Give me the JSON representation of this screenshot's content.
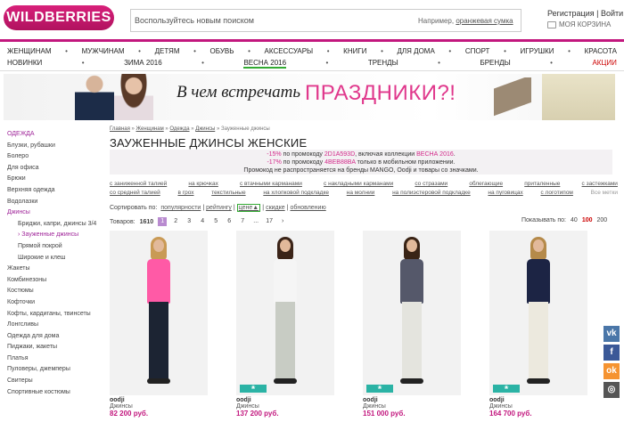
{
  "header": {
    "logo": "WILDBERRIES",
    "search_placeholder": "Воспользуйтесь новым поиском",
    "search_hint_prefix": "Например, ",
    "search_hint_link": "оранжевая сумка",
    "auth": "Регистрация | Войти",
    "cart_label": "МОЯ КОРЗИНА"
  },
  "nav": {
    "row1": [
      "ЖЕНЩИНАМ",
      "МУЖЧИНАМ",
      "ДЕТЯМ",
      "ОБУВЬ",
      "АКСЕССУАРЫ",
      "КНИГИ",
      "ДЛЯ ДОМА",
      "СПОРТ",
      "ИГРУШКИ",
      "КРАСОТА"
    ],
    "row2": [
      "НОВИНКИ",
      "ЗИМА 2016",
      "ВЕСНА 2016",
      "ТРЕНДЫ",
      "БРЕНДЫ",
      "АКЦИИ"
    ]
  },
  "banner": {
    "text": "В чем встречать",
    "highlight": "ПРАЗДНИКИ?!"
  },
  "sidebar": {
    "category": "ОДЕЖДА",
    "items": [
      {
        "label": "Блузки, рубашки",
        "type": "item"
      },
      {
        "label": "Болеро",
        "type": "item"
      },
      {
        "label": "Для офиса",
        "type": "item"
      },
      {
        "label": "Брюки",
        "type": "item"
      },
      {
        "label": "Верхняя одежда",
        "type": "item"
      },
      {
        "label": "Водолазки",
        "type": "item"
      },
      {
        "label": "Джинсы",
        "type": "active"
      },
      {
        "label": "Бриджи, капри, джинсы 3/4",
        "type": "sub"
      },
      {
        "label": "› Зауженные джинсы",
        "type": "sub-active"
      },
      {
        "label": "Прямой покрой",
        "type": "sub"
      },
      {
        "label": "Широкие и клеш",
        "type": "sub"
      },
      {
        "label": "Жакеты",
        "type": "item"
      },
      {
        "label": "Комбинезоны",
        "type": "item"
      },
      {
        "label": "Костюмы",
        "type": "item"
      },
      {
        "label": "Кофточки",
        "type": "item"
      },
      {
        "label": "Кофты, кардиганы, твинсеты",
        "type": "item"
      },
      {
        "label": "Лонгсливы",
        "type": "item"
      },
      {
        "label": "Одежда для дома",
        "type": "item"
      },
      {
        "label": "Пиджаки, жакеты",
        "type": "item"
      },
      {
        "label": "Платья",
        "type": "item"
      },
      {
        "label": "Пуловеры, джемперы",
        "type": "item"
      },
      {
        "label": "Свитеры",
        "type": "item"
      },
      {
        "label": "Спортивные костюмы",
        "type": "item"
      }
    ]
  },
  "breadcrumb": [
    "Главная",
    "Женщинам",
    "Одежда",
    "Джинсы",
    "Зауженные джинсы"
  ],
  "page_title": "ЗАУЖЕННЫЕ ДЖИНСЫ ЖЕНСКИЕ",
  "promo": {
    "l1a": "-15%",
    "l1b": " по промокоду ",
    "l1code": "2D1A593D",
    "l1c": ", включая коллекции ",
    "l1coll": "ВЕСНА 2016",
    "l1d": ".",
    "l2a": "-17%",
    "l2b": " по промокоду ",
    "l2code": "4BEB88BA",
    "l2c": " только в мобильном приложении.",
    "l3": "Промокод не распространяется на бренды MANGO, Oodji и товары со значками."
  },
  "tags": {
    "row1": [
      "с заниженной талией",
      "на крючках",
      "с втачными карманами",
      "с накладными карманами",
      "со стразами",
      "облегающие",
      "приталенные",
      "с застежками"
    ],
    "row2": [
      "со средней талией",
      "в грох",
      "текстильные",
      "на хлопковой подкладке",
      "на молнии",
      "на полиэстеровой подкладке",
      "на пуговицах",
      "с логотипом",
      "Все метки"
    ]
  },
  "sort": {
    "label": "Сортировать по:",
    "options": [
      "популярности",
      "рейтингу",
      "цене",
      "скидке",
      "обновлению"
    ]
  },
  "count": {
    "label": "Товаров:",
    "total": "1610",
    "pages": [
      "1",
      "2",
      "3",
      "4",
      "5",
      "6",
      "7",
      "...",
      "17"
    ],
    "next": "›",
    "show_label": "Показывать по:",
    "show_options": [
      "40",
      "100",
      "200"
    ]
  },
  "products": [
    {
      "brand": "oodji",
      "type": "Джинсы",
      "price": "82 200 руб.",
      "top": "#ff5aa6",
      "pants": "#1c2433",
      "hair": "#c99a55",
      "badge": ""
    },
    {
      "brand": "oodji",
      "type": "Джинсы",
      "price": "137 200 руб.",
      "top": "#f5f5f5",
      "pants": "#c8ccc4",
      "hair": "#3b2418",
      "badge": "new"
    },
    {
      "brand": "oodji",
      "type": "Джинсы",
      "price": "151 000 руб.",
      "top": "#55586a",
      "pants": "#e4e4de",
      "hair": "#3a2416",
      "badge": "new"
    },
    {
      "brand": "oodji",
      "type": "Джинсы",
      "price": "164 700 руб.",
      "top": "#1c2444",
      "pants": "#ece9de",
      "hair": "#b58a4a",
      "badge": "new"
    }
  ],
  "social": [
    {
      "name": "vk",
      "glyph": "vk",
      "color": "#4a76a8"
    },
    {
      "name": "facebook",
      "glyph": "f",
      "color": "#3b5998"
    },
    {
      "name": "odnoklassniki",
      "glyph": "ok",
      "color": "#f59331"
    },
    {
      "name": "instagram",
      "glyph": "◎",
      "color": "#555"
    }
  ]
}
